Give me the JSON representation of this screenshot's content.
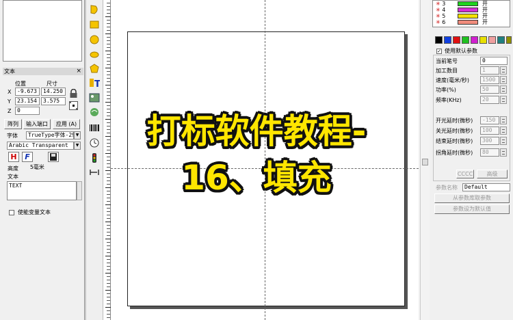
{
  "left_panel": {
    "section_title": "文本",
    "col_position": "位置",
    "col_size": "尺寸",
    "axis_x": "X",
    "axis_y": "Y",
    "axis_z": "Z",
    "x_pos": "-9.673",
    "x_size": "14.250",
    "y_pos": "23.154",
    "y_size": "3.575",
    "z_pos": "0",
    "array_button": "阵列",
    "input_port_button": "输入端口",
    "apply_button": "应用 (A)",
    "font_label": "字体",
    "font_type": "TrueType字体-295",
    "font_name": "Arabic Transparent",
    "height_label": "高度",
    "height_value": "5毫米",
    "text_label": "文本",
    "text_value": "TEXT",
    "variable_text_label": "使能变量文本"
  },
  "pens": {
    "rows": [
      {
        "num": "3",
        "color": "#1fd21f",
        "state": "开"
      },
      {
        "num": "4",
        "color": "#d62bd6",
        "state": "开"
      },
      {
        "num": "5",
        "color": "#f4e000",
        "state": "开"
      },
      {
        "num": "6",
        "color": "#f08c7c",
        "state": "开"
      }
    ],
    "palette": [
      "#000000",
      "#1040e0",
      "#e01010",
      "#20c020",
      "#d020d0",
      "#e8e000",
      "#f0a0a0",
      "#208080",
      "#909000",
      "#a0a0a0"
    ]
  },
  "params": {
    "use_default": "使用默认参数",
    "current_pen_label": "当前笔号",
    "current_pen": "0",
    "count_label": "加工数目",
    "count": "1",
    "speed_label": "速度(毫米/秒)",
    "speed": "1500",
    "power_label": "功率(%)",
    "power": "50",
    "freq_label": "频率(KHz)",
    "freq": "20",
    "on_delay_label": "开光延时(微秒)",
    "on_delay": "-150",
    "off_delay_label": "关光延时(微秒)",
    "off_delay": "100",
    "end_delay_label": "结束延时(微秒)",
    "end_delay": "300",
    "corner_delay_label": "拐角延时(微秒)",
    "corner_delay": "80",
    "color_button": "CCCC",
    "advanced_button": "高级",
    "param_name_label": "参数名称",
    "param_name": "Default",
    "from_lib_button": "从参数库取参数",
    "set_default_button": "参数设为默认值"
  },
  "overlay": {
    "line1": "打标软件教程-",
    "line2": "16、填充"
  }
}
